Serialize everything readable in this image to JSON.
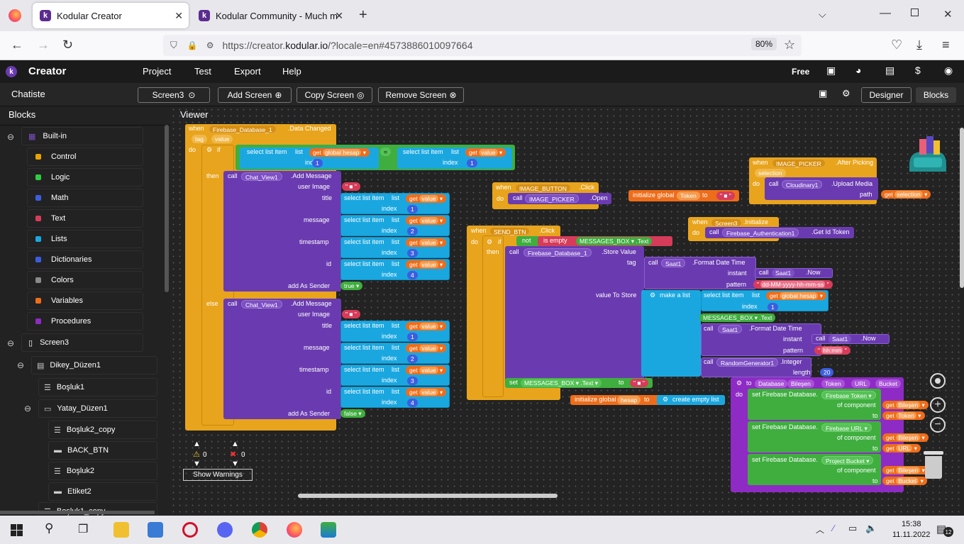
{
  "browser": {
    "tabs": [
      {
        "label": "Kodular Creator",
        "active": true
      },
      {
        "label": "Kodular Community - Much m",
        "active": false
      }
    ],
    "url_prefix": "https://creator.",
    "url_host": "kodular.io",
    "url_rest": "/?locale=en#4573886010097664",
    "zoom": "80%"
  },
  "app": {
    "name": "Creator",
    "menu": [
      "Project",
      "Test",
      "Export",
      "Help"
    ],
    "plan": "Free",
    "project_name": "Chatiste",
    "screen_select": "Screen3",
    "add_screen": "Add Screen",
    "copy_screen": "Copy Screen",
    "remove_screen": "Remove Screen",
    "designer": "Designer",
    "blocks": "Blocks"
  },
  "sidebar": {
    "title": "Blocks",
    "builtin": "Built-in",
    "builtin_items": [
      {
        "label": "Control",
        "color": "#e8a300"
      },
      {
        "label": "Logic",
        "color": "#2ecc40"
      },
      {
        "label": "Math",
        "color": "#3b5ee0"
      },
      {
        "label": "Text",
        "color": "#d63c5a"
      },
      {
        "label": "Lists",
        "color": "#1aa7e0"
      },
      {
        "label": "Dictionaries",
        "color": "#3b5ee0"
      },
      {
        "label": "Colors",
        "color": "#8a8a8a"
      },
      {
        "label": "Variables",
        "color": "#ee6d1a"
      },
      {
        "label": "Procedures",
        "color": "#8e2bc4"
      }
    ],
    "screen": "Screen3",
    "components": [
      {
        "label": "Dikey_Düzen1",
        "level": 1
      },
      {
        "label": "Boşluk1",
        "level": 2
      },
      {
        "label": "Yatay_Düzen1",
        "level": 2
      },
      {
        "label": "Boşluk2_copy",
        "level": 3
      },
      {
        "label": "BACK_BTN",
        "level": 3
      },
      {
        "label": "Boşluk2",
        "level": 3
      },
      {
        "label": "Etiket2",
        "level": 3
      },
      {
        "label": "Boşluk1_copy",
        "level": 2
      }
    ]
  },
  "viewer": {
    "title": "Viewer",
    "warnings_count": "0",
    "errors_count": "0",
    "show_warnings": "Show Warnings",
    "b1": {
      "when": "when",
      "comp": "Firebase_Database_1",
      "event": ".Data Changed",
      "p1": "tag",
      "p2": "value",
      "do": "do",
      "if": "if",
      "then": "then",
      "else": "else",
      "sli": "select list item",
      "list": "list",
      "index": "index",
      "get": "get",
      "gh": "global hesap",
      "val": "value",
      "eq": "=",
      "call": "call",
      "chat": "Chat_View1",
      "add": ".Add Message",
      "ui": "user Image",
      "title": "title",
      "msg": "message",
      "ts": "timestamp",
      "id": "id",
      "aas": "add As Sender",
      "t": "true",
      "f": "false",
      "n1": "1",
      "n2": "2",
      "n3": "3",
      "n4": "4"
    },
    "b2": {
      "when": "when",
      "comp": "IMAGE_BUTTON",
      "event": ".Click",
      "do": "do",
      "call": "call",
      "picker": "IMAGE_PICKER",
      "open": ".Open"
    },
    "b3": {
      "init": "initialize global",
      "name": "Token",
      "to": "to"
    },
    "b4": {
      "when": "when",
      "comp": "IMAGE_PICKER",
      "event": ".After Picking",
      "p": "selection",
      "do": "do",
      "call": "call",
      "cl": "Cloudinary1",
      "um": ".Upload Media",
      "path": "path",
      "get": "get",
      "sel": "selection"
    },
    "b5": {
      "when": "when",
      "comp": "Screen3",
      "event": ".Initialize",
      "do": "do",
      "call": "call",
      "auth": "Firebase_Authentication1",
      "tok": ".Get Id Token"
    },
    "b6": {
      "when": "when",
      "comp": "SEND_BTN",
      "event": ".Click",
      "do": "do",
      "if": "if",
      "then": "then",
      "not": "not",
      "empty": "is empty",
      "mb": "MESSAGES_BOX",
      "text": ".Text",
      "call": "call",
      "fdb": "Firebase_Database_1",
      "sv": ".Store Value",
      "tag": "tag",
      "saat": "Saat1",
      "fdt": ".Format Date Time",
      "instant": "instant",
      "now": ".Now",
      "pattern": "pattern",
      "p1": "dd-MM-yyyy-hh-mm-ss",
      "vts": "value To Store",
      "mal": "make a list",
      "sli": "select list item",
      "list": "list",
      "get": "get",
      "gh": "global hesap",
      "index": "index",
      "n1": "1",
      "p2": "hh:mm",
      "rg": "RandomGenerator1",
      "int": ".Integer",
      "len": "length",
      "n20": "20",
      "set": "set",
      "to": "to"
    },
    "b7": {
      "init": "initialize global",
      "name": "hesap",
      "to": "to",
      "cel": "create empty list"
    },
    "b8": {
      "to": "to",
      "proc": "Database",
      "a1": "Bileşen",
      "a2": "Token",
      "a3": "URL",
      "a4": "Bucket",
      "do": "do",
      "set": "set Firebase Database.",
      "ft": "Firebase Token",
      "fu": "Firebase URL",
      "pb": "Project Bucket",
      "oc": "of component",
      "to2": "to",
      "get": "get",
      "bil": "Bileşen",
      "tok": "Token",
      "url": "URL",
      "buc": "Bucket"
    }
  },
  "taskbar": {
    "time": "15:38",
    "date": "11.11.2022",
    "notifications": "12"
  }
}
